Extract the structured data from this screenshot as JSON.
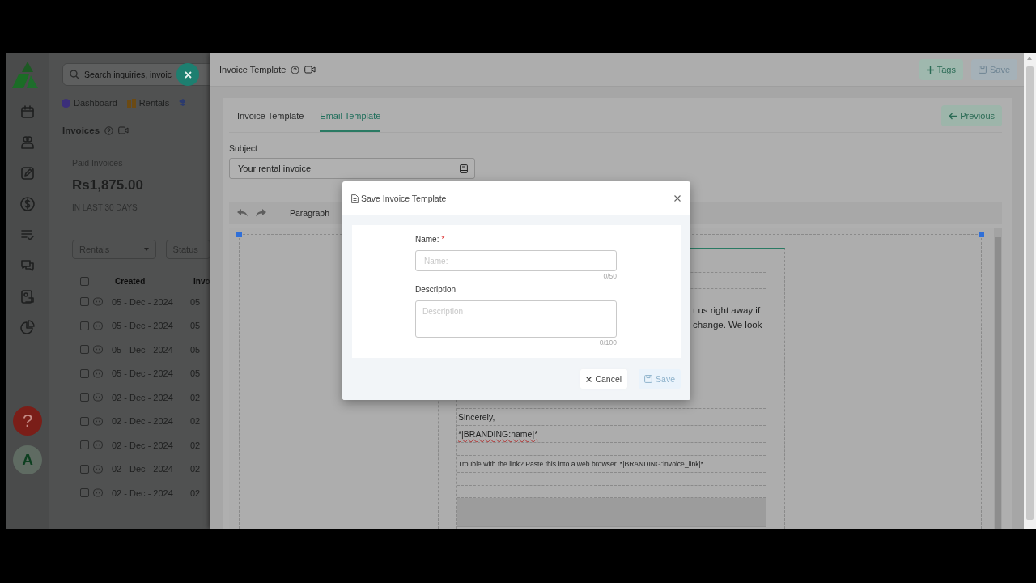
{
  "app": {
    "search": {
      "placeholder": "Search inquiries, invoic"
    },
    "nav": [
      {
        "label": "Dashboard",
        "kind": "dashboard"
      },
      {
        "label": "Rentals",
        "kind": "rentals"
      }
    ],
    "page_title": "Invoices",
    "stat_card": {
      "label": "Paid Invoices",
      "value": "Rs1,875.00",
      "period": "IN LAST 30 DAYS"
    },
    "filters": [
      {
        "label": "Rentals",
        "kind": "dropdown"
      },
      {
        "label": "Status",
        "kind": "field"
      }
    ],
    "help_button": "?",
    "avatar": "A"
  },
  "table": {
    "header_checked": false,
    "columns": [
      "Created",
      "Invo"
    ],
    "rows": [
      {
        "checked": false,
        "created": "05 - Dec - 2024",
        "column_2": "05"
      },
      {
        "checked": false,
        "created": "05 - Dec - 2024",
        "column_2": "05"
      },
      {
        "checked": false,
        "created": "05 - Dec - 2024",
        "column_2": "05"
      },
      {
        "checked": false,
        "created": "05 - Dec - 2024",
        "column_2": "05"
      },
      {
        "checked": false,
        "created": "02 - Dec - 2024",
        "column_2": "02"
      },
      {
        "checked": false,
        "created": "02 - Dec - 2024",
        "column_2": "02"
      },
      {
        "checked": false,
        "created": "02 - Dec - 2024",
        "column_2": "02"
      },
      {
        "checked": false,
        "created": "02 - Dec - 2024",
        "column_2": "02"
      },
      {
        "checked": false,
        "created": "02 - Dec - 2024",
        "column_2": "02"
      }
    ]
  },
  "drawer": {
    "title": "Invoice Template",
    "header_buttons": [
      {
        "label": "Tags",
        "kind": "tags",
        "disabled": false
      },
      {
        "label": "Save",
        "kind": "save",
        "disabled": true
      }
    ],
    "tabs": [
      {
        "label": "Invoice Template",
        "selected": false
      },
      {
        "label": "Email Template",
        "selected": true
      }
    ],
    "previous_button": "Previous",
    "subject": {
      "label": "Subject",
      "value": "Your rental invoice"
    },
    "editor": {
      "block_format": "Paragraph",
      "lines": [
        {
          "kind": "cut",
          "text": "t us right away if"
        },
        {
          "kind": "cut",
          "text": "change. We look"
        },
        {
          "kind": "plain",
          "text": "Sincerely,"
        },
        {
          "kind": "merge_tag",
          "text": "*|BRANDING:name|*"
        },
        {
          "kind": "small",
          "text": "Trouble with the link? Paste this into a web browser. *|BRANDING:invoice_link|*"
        }
      ]
    }
  },
  "dialog": {
    "title": "Save Invoice Template",
    "fields": [
      {
        "kind": "input",
        "label": "Name:",
        "required_mark": "*",
        "placeholder": "Name:",
        "counter": "0/50"
      },
      {
        "kind": "textarea",
        "label": "Description",
        "placeholder": "Description",
        "counter": "0/100"
      }
    ],
    "buttons": [
      {
        "kind": "cancel",
        "label": "Cancel",
        "disabled": false
      },
      {
        "kind": "save",
        "label": "Save",
        "disabled": true
      }
    ]
  }
}
